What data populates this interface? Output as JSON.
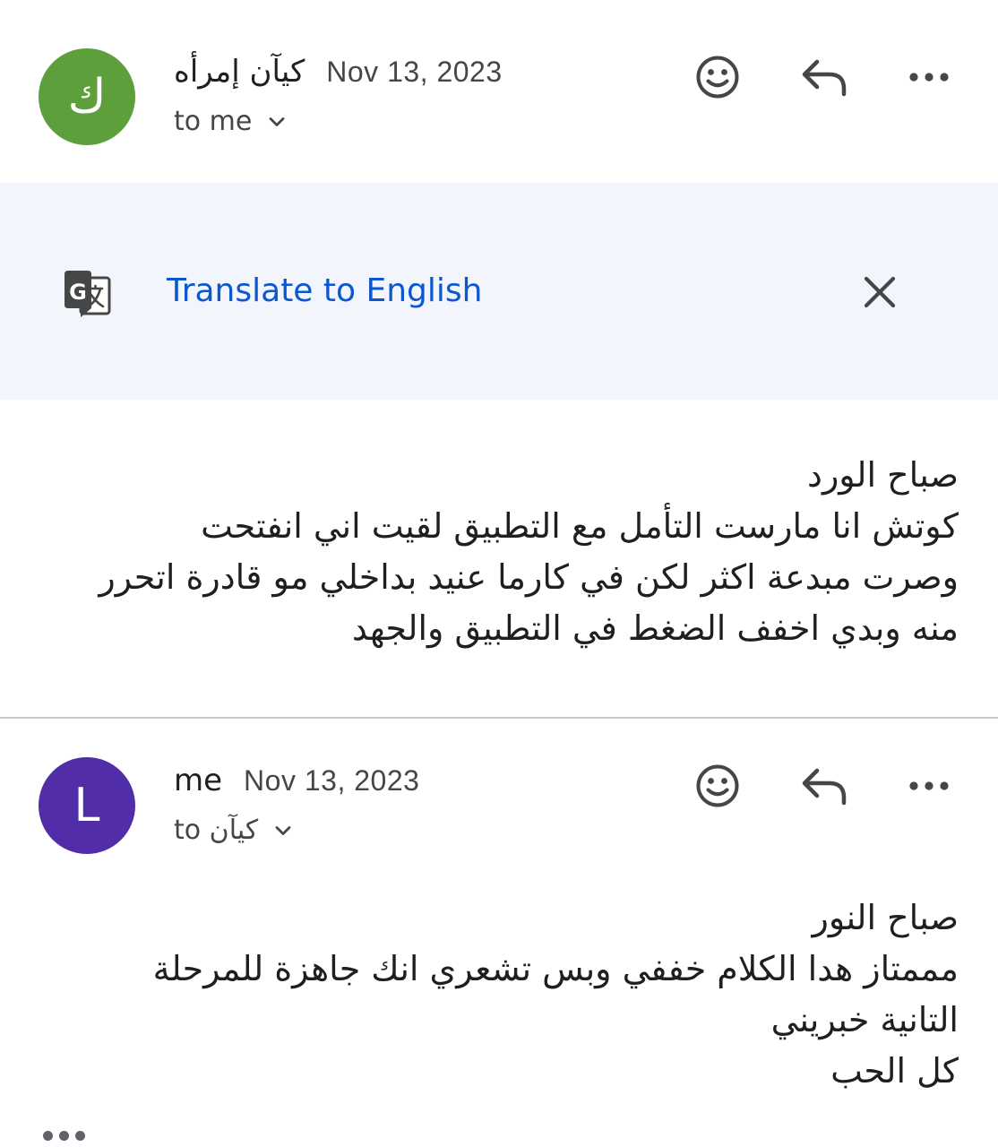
{
  "messages": [
    {
      "avatar_letter": "ك",
      "avatar_color": "#5d9f3a",
      "sender": "كيآن إمرأه",
      "date": "Nov 13, 2023",
      "recipient": "to me",
      "body_lines": [
        "صباح الورد",
        "كوتش انا مارست التأمل مع التطبيق لقيت اني انفتحت",
        "وصرت مبدعة اكثر لكن في كارما عنيد بداخلي مو قادرة اتحرر",
        "منه وبدي اخفف الضغط في التطبيق والجهد"
      ]
    },
    {
      "avatar_letter": "L",
      "avatar_color": "#512da8",
      "sender": "me",
      "date": "Nov 13, 2023",
      "recipient": "to كيآن",
      "body_lines": [
        "صباح النور",
        "مممتاز هدا الكلام خففي وبس تشعري انك جاهزة للمرحلة",
        "التانية خبريني",
        "كل الحب"
      ]
    }
  ],
  "translate": {
    "link_label": "Translate to English",
    "background": "#f2f5fb",
    "link_color": "#0b57d0"
  },
  "icons": {
    "react": "emoji-smile-icon",
    "reply": "reply-arrow-icon",
    "more": "more-horizontal-icon",
    "translate": "google-translate-icon",
    "close": "close-icon",
    "expand": "chevron-down-icon",
    "trimmed": "show-trimmed-content-icon"
  }
}
